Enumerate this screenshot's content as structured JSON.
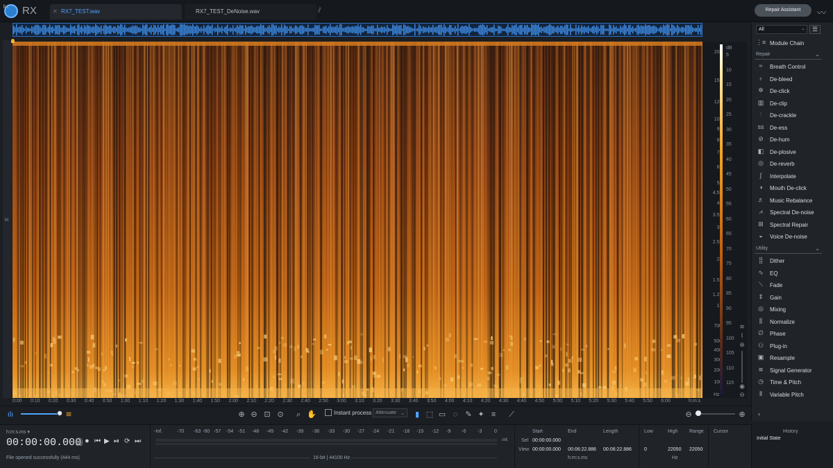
{
  "app": {
    "logo_text": "RX"
  },
  "tabs": [
    {
      "label": "RX7_TEST.wav",
      "active": true
    },
    {
      "label": "RX7_TEST_DeNoise.wav",
      "active": false
    }
  ],
  "header": {
    "repair_assistant": "Repair Assistant"
  },
  "spectrogram": {
    "channel_label": "M",
    "hz_ticks": [
      "20k",
      "15k",
      "12k",
      "10k",
      "9k",
      "8k",
      "7k",
      "6k",
      "5k",
      "4.5k",
      "4k",
      "3.5k",
      "3k",
      "2.5k",
      "2k",
      "1.5k",
      "1.2k",
      "1k",
      "700",
      "500",
      "400",
      "300",
      "200",
      "100"
    ],
    "db_ticks": [
      "5",
      "10",
      "15",
      "20",
      "25",
      "30",
      "35",
      "40",
      "45",
      "50",
      "55",
      "60",
      "65",
      "70",
      "75",
      "80",
      "85",
      "90",
      "95",
      "100",
      "105",
      "110",
      "115"
    ],
    "db_label": "dB",
    "hz_label": "Hz",
    "time_ticks": [
      "0:00",
      "0:10",
      "0:20",
      "0:30",
      "0:40",
      "0:50",
      "1:00",
      "1:10",
      "1:20",
      "1:30",
      "1:40",
      "1:50",
      "2:00",
      "2:10",
      "2:20",
      "2:30",
      "2:40",
      "2:50",
      "3:00",
      "3:10",
      "3:20",
      "3:30",
      "3:40",
      "3:50",
      "4:00",
      "4:10",
      "4:20",
      "4:30",
      "4:40",
      "4:50",
      "5:00",
      "5:10",
      "5:20",
      "5:30",
      "5:40",
      "5:50",
      "6:00"
    ],
    "time_unit": "h:m:s",
    "colors": {
      "accent": "#4ea3ff",
      "heat_high": "#f5a623",
      "heat_low": "#1a1410"
    }
  },
  "toolbar": {
    "instant_process": "Instant process",
    "attenuate": "Attenuate"
  },
  "transport": {
    "time_format": "h:m:s.ms",
    "timecode": "00:00:00.000",
    "status": "File opened successfully (444 ms)"
  },
  "meter": {
    "ticks": [
      "-Inf.",
      "-70",
      "-63",
      "-60",
      "-57",
      "-54",
      "-51",
      "-48",
      "-45",
      "-42",
      "-39",
      "-36",
      "-33",
      "-30",
      "-27",
      "-24",
      "-21",
      "-18",
      "-15",
      "-12",
      "-9",
      "-6",
      "-3",
      "0"
    ],
    "end_label": "-Inf.",
    "format": "16-bit | 44100 Hz"
  },
  "selection": {
    "start_label": "Start",
    "end_label": "End",
    "length_label": "Length",
    "sel_label": "Sel",
    "view_label": "View",
    "sel_start": "00:00:00.000",
    "view_start": "00:00:00.000",
    "view_end": "00:06:22.886",
    "view_length": "00:06:22.886",
    "unit": "h:m:s.ms",
    "low_label": "Low",
    "high_label": "High",
    "range_label": "Range",
    "low": "0",
    "high": "22050",
    "range": "22050",
    "freq_unit": "Hz",
    "cursor_label": "Cursor"
  },
  "modules": {
    "filter": "All",
    "module_chain": "Module Chain",
    "repair_section": "Repair",
    "repair": [
      {
        "label": "Breath Control",
        "icon": "breath-icon"
      },
      {
        "label": "De-bleed",
        "icon": "de-bleed-icon"
      },
      {
        "label": "De-click",
        "icon": "de-click-icon"
      },
      {
        "label": "De-clip",
        "icon": "de-clip-icon"
      },
      {
        "label": "De-crackle",
        "icon": "de-crackle-icon"
      },
      {
        "label": "De-ess",
        "icon": "de-ess-icon"
      },
      {
        "label": "De-hum",
        "icon": "de-hum-icon"
      },
      {
        "label": "De-plosive",
        "icon": "de-plosive-icon"
      },
      {
        "label": "De-reverb",
        "icon": "de-reverb-icon"
      },
      {
        "label": "Interpolate",
        "icon": "interpolate-icon"
      },
      {
        "label": "Mouth De-click",
        "icon": "mouth-de-click-icon"
      },
      {
        "label": "Music Rebalance",
        "icon": "music-rebalance-icon"
      },
      {
        "label": "Spectral De-noise",
        "icon": "spectral-de-noise-icon"
      },
      {
        "label": "Spectral Repair",
        "icon": "spectral-repair-icon"
      },
      {
        "label": "Voice De-noise",
        "icon": "voice-de-noise-icon"
      }
    ],
    "utility_section": "Utility",
    "utility": [
      {
        "label": "Dither",
        "icon": "dither-icon"
      },
      {
        "label": "EQ",
        "icon": "eq-icon"
      },
      {
        "label": "Fade",
        "icon": "fade-icon"
      },
      {
        "label": "Gain",
        "icon": "gain-icon"
      },
      {
        "label": "Mixing",
        "icon": "mixing-icon"
      },
      {
        "label": "Normalize",
        "icon": "normalize-icon"
      },
      {
        "label": "Phase",
        "icon": "phase-icon"
      },
      {
        "label": "Plug-in",
        "icon": "plug-in-icon"
      },
      {
        "label": "Resample",
        "icon": "resample-icon"
      },
      {
        "label": "Signal Generator",
        "icon": "signal-generator-icon"
      },
      {
        "label": "Time & Pitch",
        "icon": "time-pitch-icon"
      },
      {
        "label": "Variable Pitch",
        "icon": "variable-pitch-icon"
      }
    ]
  },
  "history": {
    "title": "History",
    "items": [
      "Initial State"
    ]
  }
}
